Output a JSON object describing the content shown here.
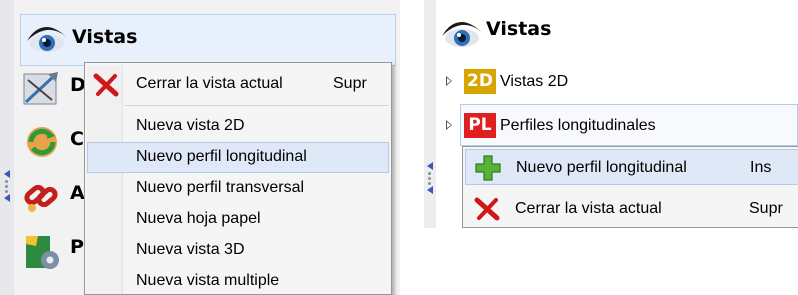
{
  "left": {
    "root_label": "Vistas",
    "items": [
      {
        "label": "D",
        "icon": "drawing-icon"
      },
      {
        "label": "C",
        "icon": "refresh-icon"
      },
      {
        "label": "A",
        "icon": "link-icon"
      },
      {
        "label": "P",
        "icon": "gear-icon"
      }
    ],
    "menu": [
      {
        "label": "Cerrar la vista actual",
        "shortcut": "Supr",
        "icon": "close-icon"
      },
      {
        "label": "Nueva vista 2D",
        "shortcut": ""
      },
      {
        "label": "Nuevo perfil longitudinal",
        "shortcut": "",
        "highlighted": true
      },
      {
        "label": "Nuevo perfil transversal",
        "shortcut": ""
      },
      {
        "label": "Nueva hoja papel",
        "shortcut": ""
      },
      {
        "label": "Nueva vista 3D",
        "shortcut": ""
      },
      {
        "label": "Nueva vista multiple",
        "shortcut": ""
      }
    ]
  },
  "right": {
    "root_label": "Vistas",
    "items": [
      {
        "badge": "2D",
        "label": "Vistas 2D",
        "badge_color": "#d8a400"
      },
      {
        "badge": "PL",
        "label": "Perfiles longitudinales",
        "badge_color": "#e02020"
      }
    ],
    "menu": [
      {
        "label": "Nuevo perfil longitudinal",
        "shortcut": "Ins",
        "icon": "plus-icon",
        "highlighted": true
      },
      {
        "label": "Cerrar la vista actual",
        "shortcut": "Supr",
        "icon": "close-icon"
      }
    ]
  }
}
